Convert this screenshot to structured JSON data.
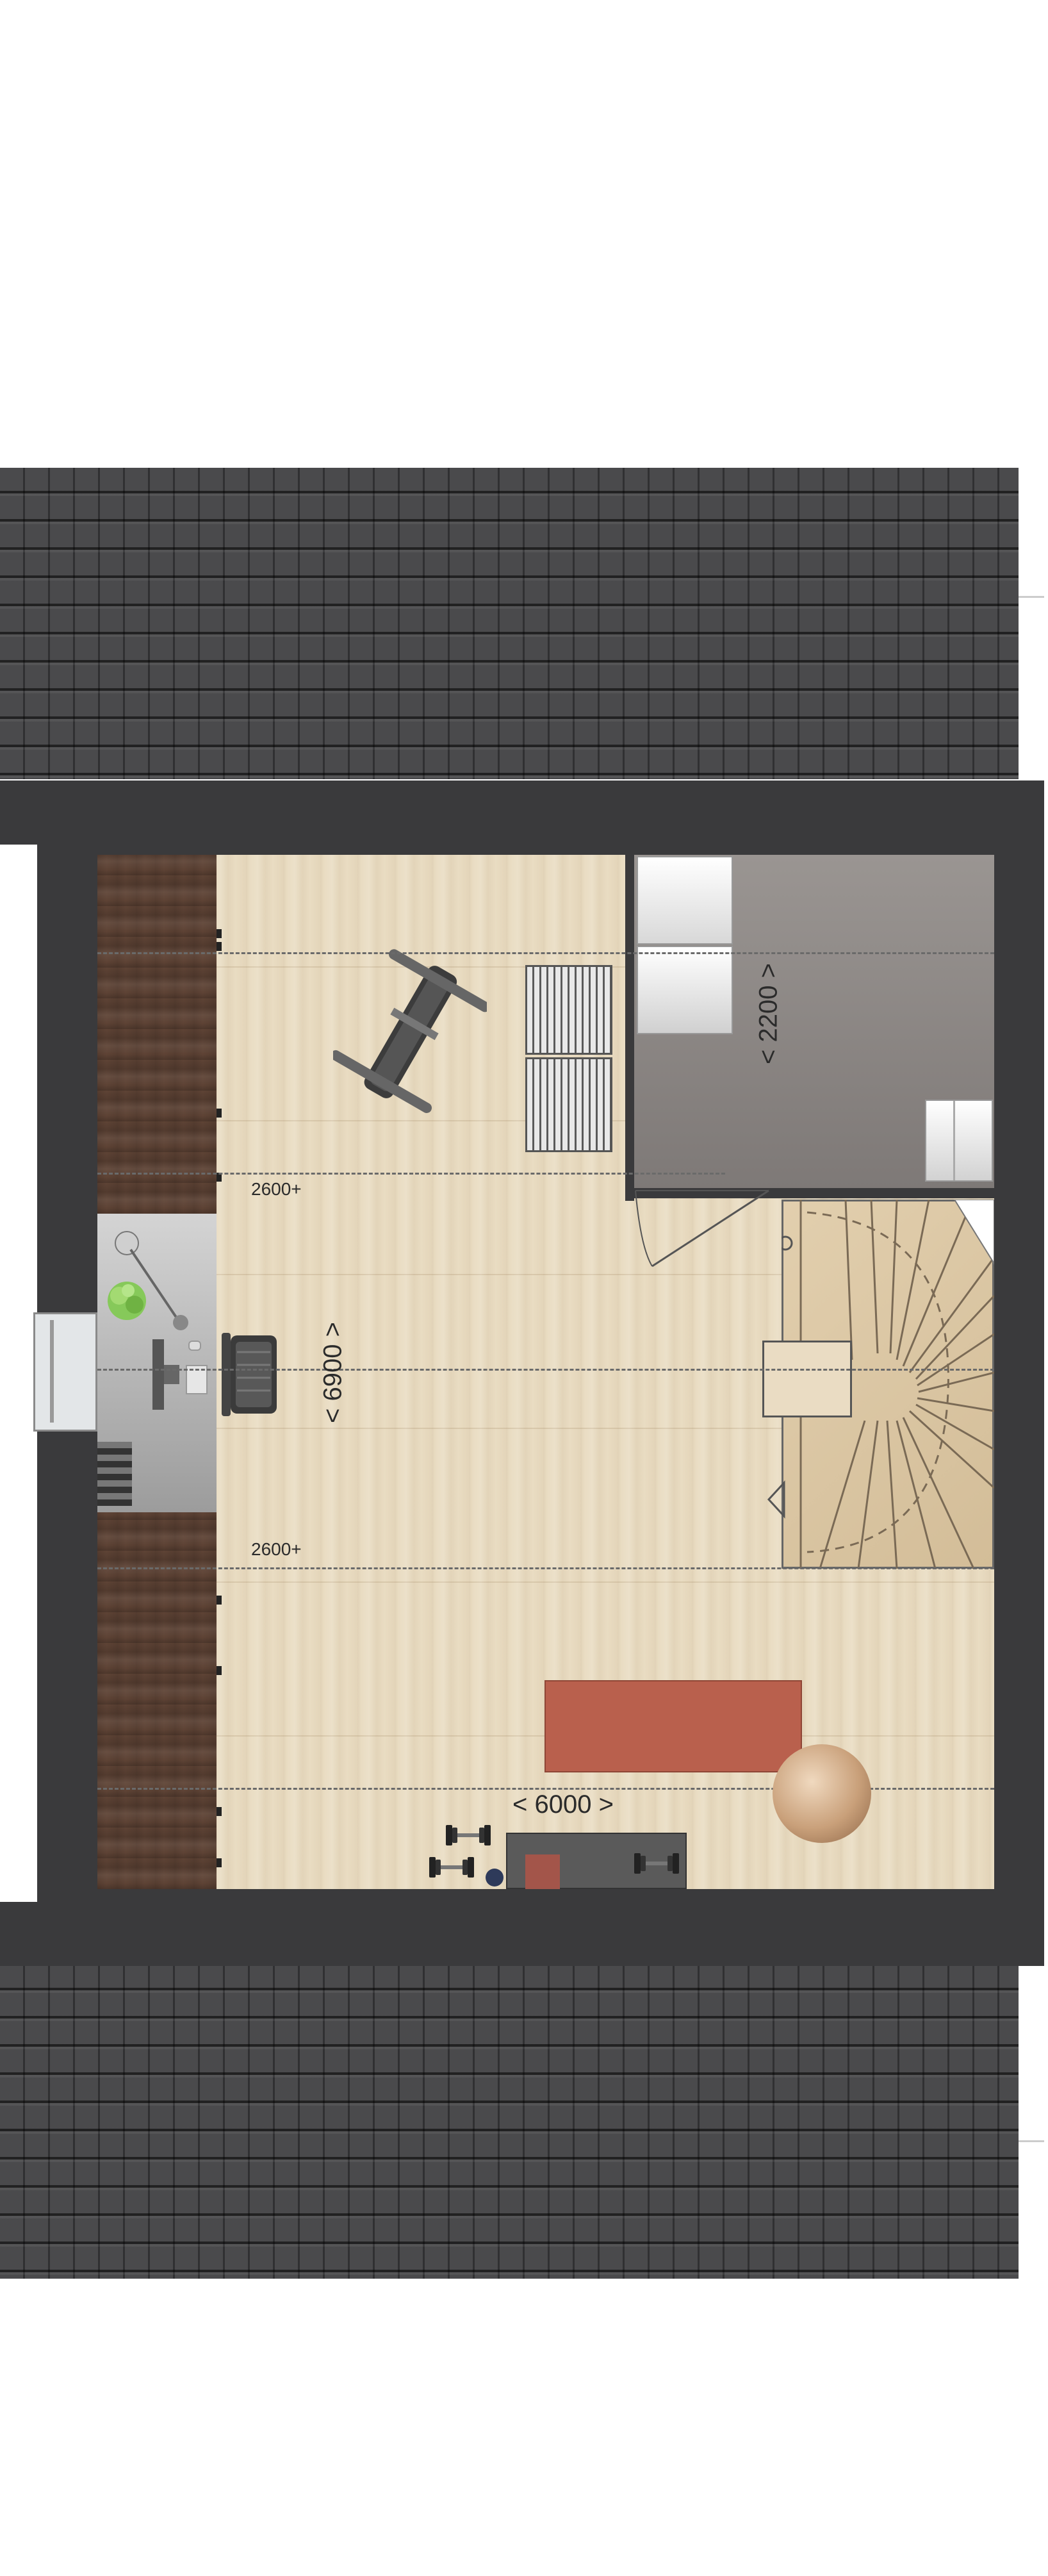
{
  "plan": {
    "dimensions": {
      "width_label": "< 6000 >",
      "depth_label": "< 6900 >",
      "storage_label": "< 2200 >"
    },
    "height_marks": {
      "upper": "2600+",
      "lower": "2600+"
    }
  }
}
